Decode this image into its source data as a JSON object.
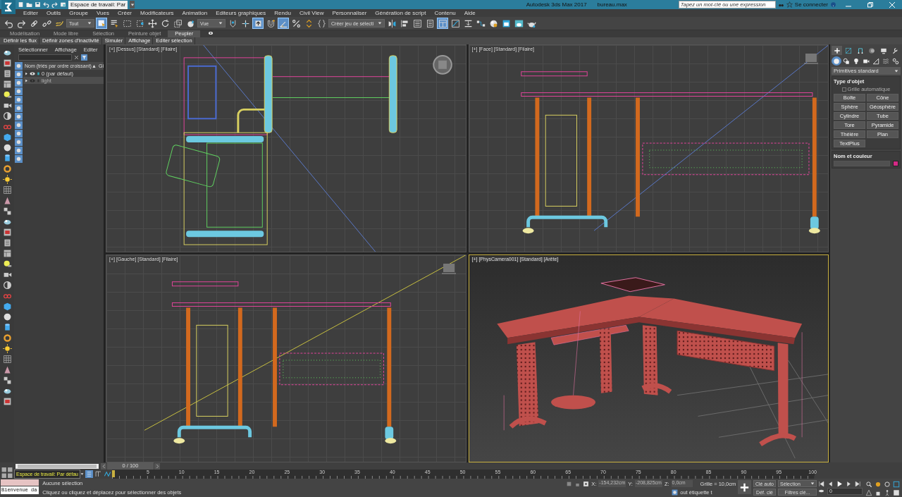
{
  "title_bar": {
    "workspace": "Espace de travail: Par",
    "app_title": "Autodesk 3ds Max 2017",
    "file_name": "bureau.max",
    "search_placeholder": "Tapez un mot-clé ou une expression",
    "sign_in": "Se connecter"
  },
  "menu": [
    "Editer",
    "Outils",
    "Groupe",
    "Vues",
    "Créer",
    "Modificateurs",
    "Animation",
    "Editeurs graphiques",
    "Rendu",
    "Civil View",
    "Personnaliser",
    "Génération de script",
    "Contenu",
    "Aide"
  ],
  "toolbar": [
    {
      "kind": "undo",
      "selected": false
    },
    {
      "kind": "redo",
      "selected": false
    },
    {
      "kind": "link",
      "selected": false
    },
    {
      "kind": "unlink",
      "selected": false
    },
    {
      "kind": "bind",
      "selected": false
    },
    {
      "kind": "dropdown",
      "label": "Tout"
    },
    {
      "kind": "select",
      "selected": true
    },
    {
      "kind": "select-name",
      "selected": false
    },
    {
      "kind": "rect-region",
      "selected": false
    },
    {
      "kind": "window",
      "selected": false
    },
    {
      "kind": "move",
      "selected": false
    },
    {
      "kind": "rotate",
      "selected": false
    },
    {
      "kind": "scale",
      "selected": false
    },
    {
      "kind": "placement",
      "selected": false
    },
    {
      "kind": "dropdown",
      "label": "Vue"
    },
    {
      "kind": "pivot",
      "selected": false
    },
    {
      "kind": "manipulate",
      "selected": false
    },
    {
      "kind": "shortcut",
      "selected": true
    },
    {
      "kind": "snap",
      "selected": false
    },
    {
      "kind": "angle-snap",
      "selected": true
    },
    {
      "kind": "percent-snap",
      "selected": false
    },
    {
      "kind": "spinner-snap",
      "selected": false
    },
    {
      "kind": "named-sets",
      "selected": false
    },
    {
      "kind": "dropdown",
      "label": "Créer jeu de sélecti"
    },
    {
      "kind": "mirror",
      "selected": false
    },
    {
      "kind": "align",
      "selected": false
    },
    {
      "kind": "scene-list",
      "selected": false
    },
    {
      "kind": "layer-list",
      "selected": false
    },
    {
      "kind": "ribbon",
      "selected": true
    },
    {
      "kind": "curve",
      "selected": false
    },
    {
      "kind": "dope",
      "selected": false
    },
    {
      "kind": "schematic",
      "selected": false
    },
    {
      "kind": "material",
      "selected": false
    },
    {
      "kind": "render-setup",
      "selected": false
    },
    {
      "kind": "frame",
      "selected": false
    },
    {
      "kind": "teapot",
      "selected": false
    }
  ],
  "ribbon": {
    "tabs": [
      {
        "label": "Modélisation",
        "selected": false
      },
      {
        "label": "Mode libre",
        "selected": false
      },
      {
        "label": "Sélection",
        "selected": false
      },
      {
        "label": "Peinture objet",
        "selected": false
      },
      {
        "label": "Peupler",
        "selected": true
      }
    ],
    "commands": [
      "Définir les flux",
      "Définir zones d'inactivité",
      "Simuler",
      "Affichage",
      "Editer sélection"
    ]
  },
  "scene_explorer": {
    "menu": [
      "Sélectionner",
      "Affichage",
      "Editer"
    ],
    "column_name": "Nom (triés par ordre croissant)",
    "sort_mark": "▲",
    "column_2": "Gi",
    "rows": [
      {
        "name": "0 (par défaut)",
        "visible": true,
        "selected": false
      },
      {
        "name": "light",
        "visible": false,
        "selected": true
      }
    ]
  },
  "viewports": [
    {
      "kind": "top",
      "label": "[+] [Dessus] [Standard] [Filaire]",
      "active": false
    },
    {
      "kind": "front",
      "label": "[+] [Face] [Standard] [Filaire]",
      "active": false
    },
    {
      "kind": "left",
      "label": "[+] [Gauche] [Standard] [Filaire]",
      "active": false
    },
    {
      "kind": "camera",
      "label": "[+] [PhysCamera001] [Standard] [Arête]",
      "active": true
    }
  ],
  "command_panel": {
    "tabs": [
      {
        "kind": "create",
        "selected": true
      },
      {
        "kind": "modify",
        "selected": false
      },
      {
        "kind": "hierarchy",
        "selected": false
      },
      {
        "kind": "motion",
        "selected": false
      },
      {
        "kind": "display",
        "selected": false
      },
      {
        "kind": "utilities",
        "selected": false
      }
    ],
    "subtabs": [
      {
        "kind": "geometry",
        "selected": true
      },
      {
        "kind": "shapes",
        "selected": false
      },
      {
        "kind": "lights",
        "selected": false
      },
      {
        "kind": "cameras",
        "selected": false
      },
      {
        "kind": "helpers",
        "selected": false
      },
      {
        "kind": "spacewarps",
        "selected": false
      },
      {
        "kind": "systems",
        "selected": false
      }
    ],
    "category": "Primitives standard",
    "rollout_1": "Type d'objet",
    "auto_grid": {
      "label": "Grille automatique",
      "checked": false,
      "disabled": true
    },
    "buttons": [
      "Boîte",
      "Cône",
      "Sphère",
      "Géosphère",
      "Cylindre",
      "Tube",
      "Tore",
      "Pyramide",
      "Théière",
      "Plan",
      "TextPlus"
    ],
    "rollout_2": "Nom et couleur",
    "color": "#d42a86"
  },
  "timeline": {
    "position": "0 / 100",
    "ruler": [
      "5",
      "10",
      "15",
      "20",
      "25",
      "30",
      "35",
      "40",
      "45",
      "50",
      "55",
      "60",
      "65",
      "70",
      "75",
      "80",
      "85",
      "90",
      "95",
      "100"
    ]
  },
  "workspace": "Espace de travail: Par défau",
  "status": {
    "listener_output": "Bienvenue da",
    "selection": "Aucune sélection",
    "prompt": "Cliquez ou cliquez et déplacez pour sélectionner des objets",
    "x_label": "X:",
    "x": "-154,232cm",
    "y_label": "Y:",
    "y": "-208,825cm",
    "z_label": "Z:",
    "z": "0,0cm",
    "grid": "Grille = 10,0cm",
    "time_tag": "out étiquette t",
    "auto_key": "Clé auto",
    "key_mode": "Sélection",
    "set_key": "Déf. clé",
    "key_filters": "Filtres clé...",
    "frame": "0"
  }
}
